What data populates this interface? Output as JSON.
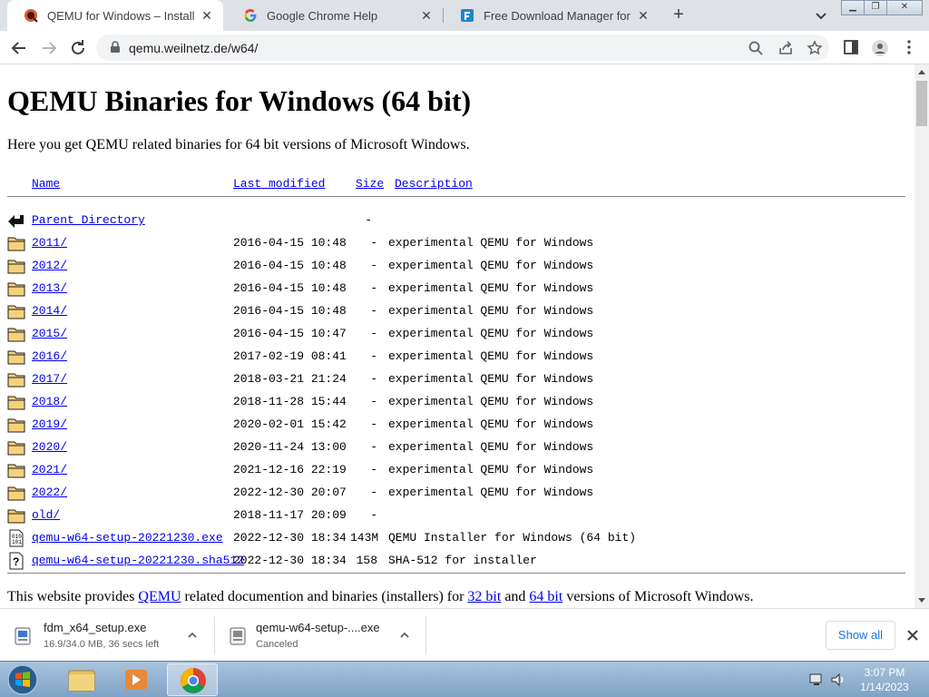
{
  "tabs": [
    {
      "title": "QEMU for Windows – Installers (",
      "active": true,
      "favicon": "qemu-icon"
    },
    {
      "title": "Google Chrome Help",
      "active": false,
      "favicon": "google-g-icon"
    },
    {
      "title": "Free Download Manager for Win",
      "active": false,
      "favicon": "fdm-icon"
    }
  ],
  "address_bar": {
    "url": "qemu.weilnetz.de/w64/"
  },
  "page": {
    "title": "QEMU Binaries for Windows (64 bit)",
    "intro": "Here you get QEMU related binaries for 64 bit versions of Microsoft Windows.",
    "headers": {
      "name": "Name",
      "last_modified": "Last modified",
      "size": "Size",
      "description": "Description"
    },
    "parent": {
      "name": "Parent Directory",
      "size": "-"
    },
    "rows": [
      {
        "icon": "folder",
        "name": "2011/",
        "date": "2016-04-15 10:48",
        "size": "-",
        "desc": "experimental QEMU for Windows"
      },
      {
        "icon": "folder",
        "name": "2012/",
        "date": "2016-04-15 10:48",
        "size": "-",
        "desc": "experimental QEMU for Windows"
      },
      {
        "icon": "folder",
        "name": "2013/",
        "date": "2016-04-15 10:48",
        "size": "-",
        "desc": "experimental QEMU for Windows"
      },
      {
        "icon": "folder",
        "name": "2014/",
        "date": "2016-04-15 10:48",
        "size": "-",
        "desc": "experimental QEMU for Windows"
      },
      {
        "icon": "folder",
        "name": "2015/",
        "date": "2016-04-15 10:47",
        "size": "-",
        "desc": "experimental QEMU for Windows"
      },
      {
        "icon": "folder",
        "name": "2016/",
        "date": "2017-02-19 08:41",
        "size": "-",
        "desc": "experimental QEMU for Windows"
      },
      {
        "icon": "folder",
        "name": "2017/",
        "date": "2018-03-21 21:24",
        "size": "-",
        "desc": "experimental QEMU for Windows"
      },
      {
        "icon": "folder",
        "name": "2018/",
        "date": "2018-11-28 15:44",
        "size": "-",
        "desc": "experimental QEMU for Windows"
      },
      {
        "icon": "folder",
        "name": "2019/",
        "date": "2020-02-01 15:42",
        "size": "-",
        "desc": "experimental QEMU for Windows"
      },
      {
        "icon": "folder",
        "name": "2020/",
        "date": "2020-11-24 13:00",
        "size": "-",
        "desc": "experimental QEMU for Windows"
      },
      {
        "icon": "folder",
        "name": "2021/",
        "date": "2021-12-16 22:19",
        "size": "-",
        "desc": "experimental QEMU for Windows"
      },
      {
        "icon": "folder",
        "name": "2022/",
        "date": "2022-12-30 20:07",
        "size": "-",
        "desc": "experimental QEMU for Windows"
      },
      {
        "icon": "folder",
        "name": "old/",
        "date": "2018-11-17 20:09",
        "size": "-",
        "desc": ""
      },
      {
        "icon": "binary",
        "name": "qemu-w64-setup-20221230.exe",
        "date": "2022-12-30 18:34",
        "size": "143M",
        "desc": "QEMU Installer for Windows (64 bit)"
      },
      {
        "icon": "unknown",
        "name": "qemu-w64-setup-20221230.sha512",
        "date": "2022-12-30 18:34",
        "size": "158",
        "desc": "SHA-512 for installer"
      }
    ],
    "footer": {
      "prefix": "This website provides ",
      "link_qemu": "QEMU",
      "middle": " related documention and binaries (installers) for ",
      "link_32": "32 bit",
      "and": " and ",
      "link_64": "64 bit",
      "suffix": " versions of Microsoft Windows."
    }
  },
  "downloads": [
    {
      "file": "fdm_x64_setup.exe",
      "status": "16.9/34.0 MB, 36 secs left"
    },
    {
      "file": "qemu-w64-setup-....exe",
      "status": "Canceled"
    }
  ],
  "downloads_show_all": "Show all",
  "taskbar": {
    "time": "3:07 PM",
    "date": "1/14/2023"
  }
}
